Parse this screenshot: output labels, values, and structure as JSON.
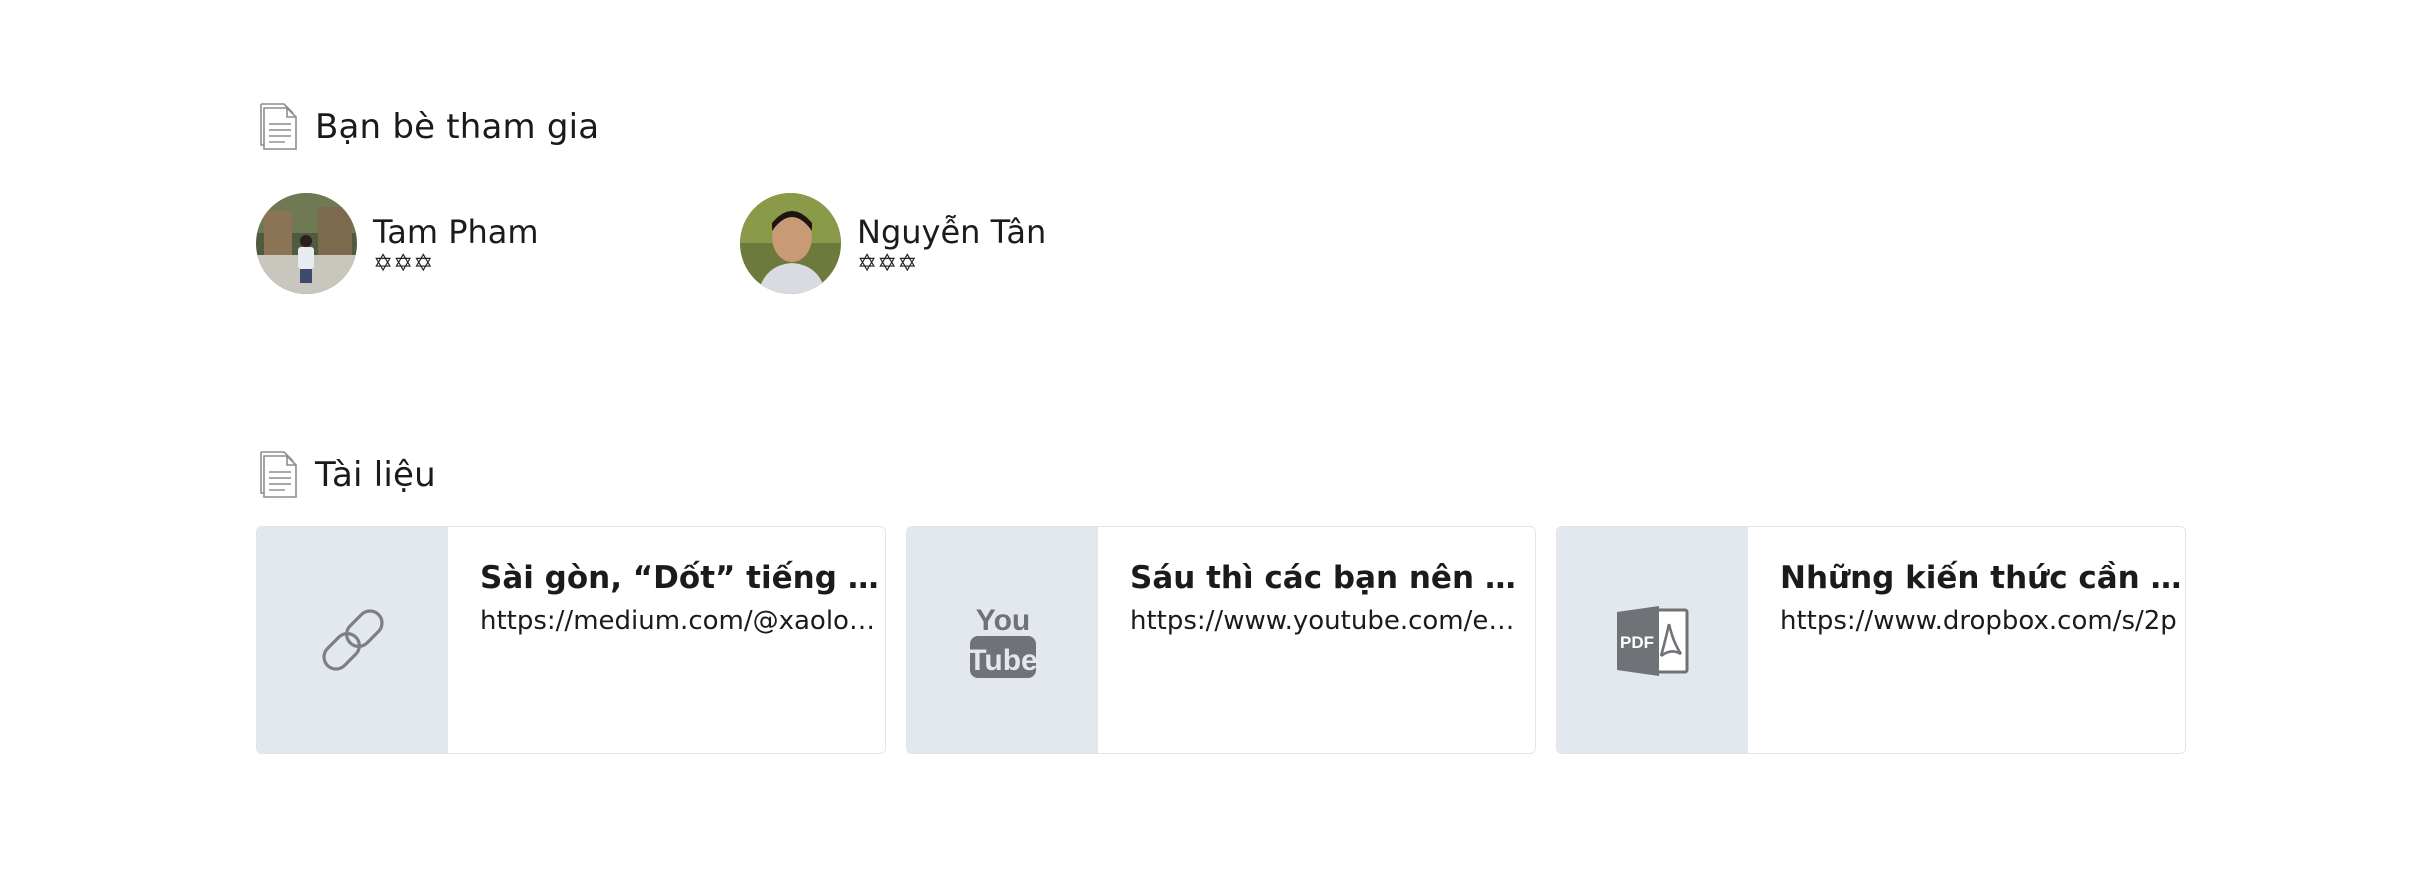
{
  "friends_section": {
    "title": "Bạn bè tham gia",
    "icon": "document-icon",
    "friends": [
      {
        "name": "Tam Pham",
        "stars": "✡✡✡"
      },
      {
        "name": "Nguyễn Tân",
        "stars": "✡✡✡"
      }
    ]
  },
  "documents_section": {
    "title": "Tài liệu",
    "icon": "document-icon",
    "items": [
      {
        "type": "link",
        "icon": "link-icon",
        "title": "Sài gòn, “Dốt” tiếng anh lắm",
        "url": "https://medium.com/@xaolonisme"
      },
      {
        "type": "youtube",
        "icon": "youtube-icon",
        "title": "Sáu thì các bạn nên ưu tiên học",
        "url": "https://www.youtube.com/embed/"
      },
      {
        "type": "pdf",
        "icon": "pdf-icon",
        "title": "Những kiến thức cần chuẩn bị",
        "url": "https://www.dropbox.com/s/2p"
      }
    ]
  },
  "colors": {
    "thumb_bg": "#e2e8ee",
    "icon_gray": "#7c7f83",
    "card_border": "#e1e5ea"
  }
}
